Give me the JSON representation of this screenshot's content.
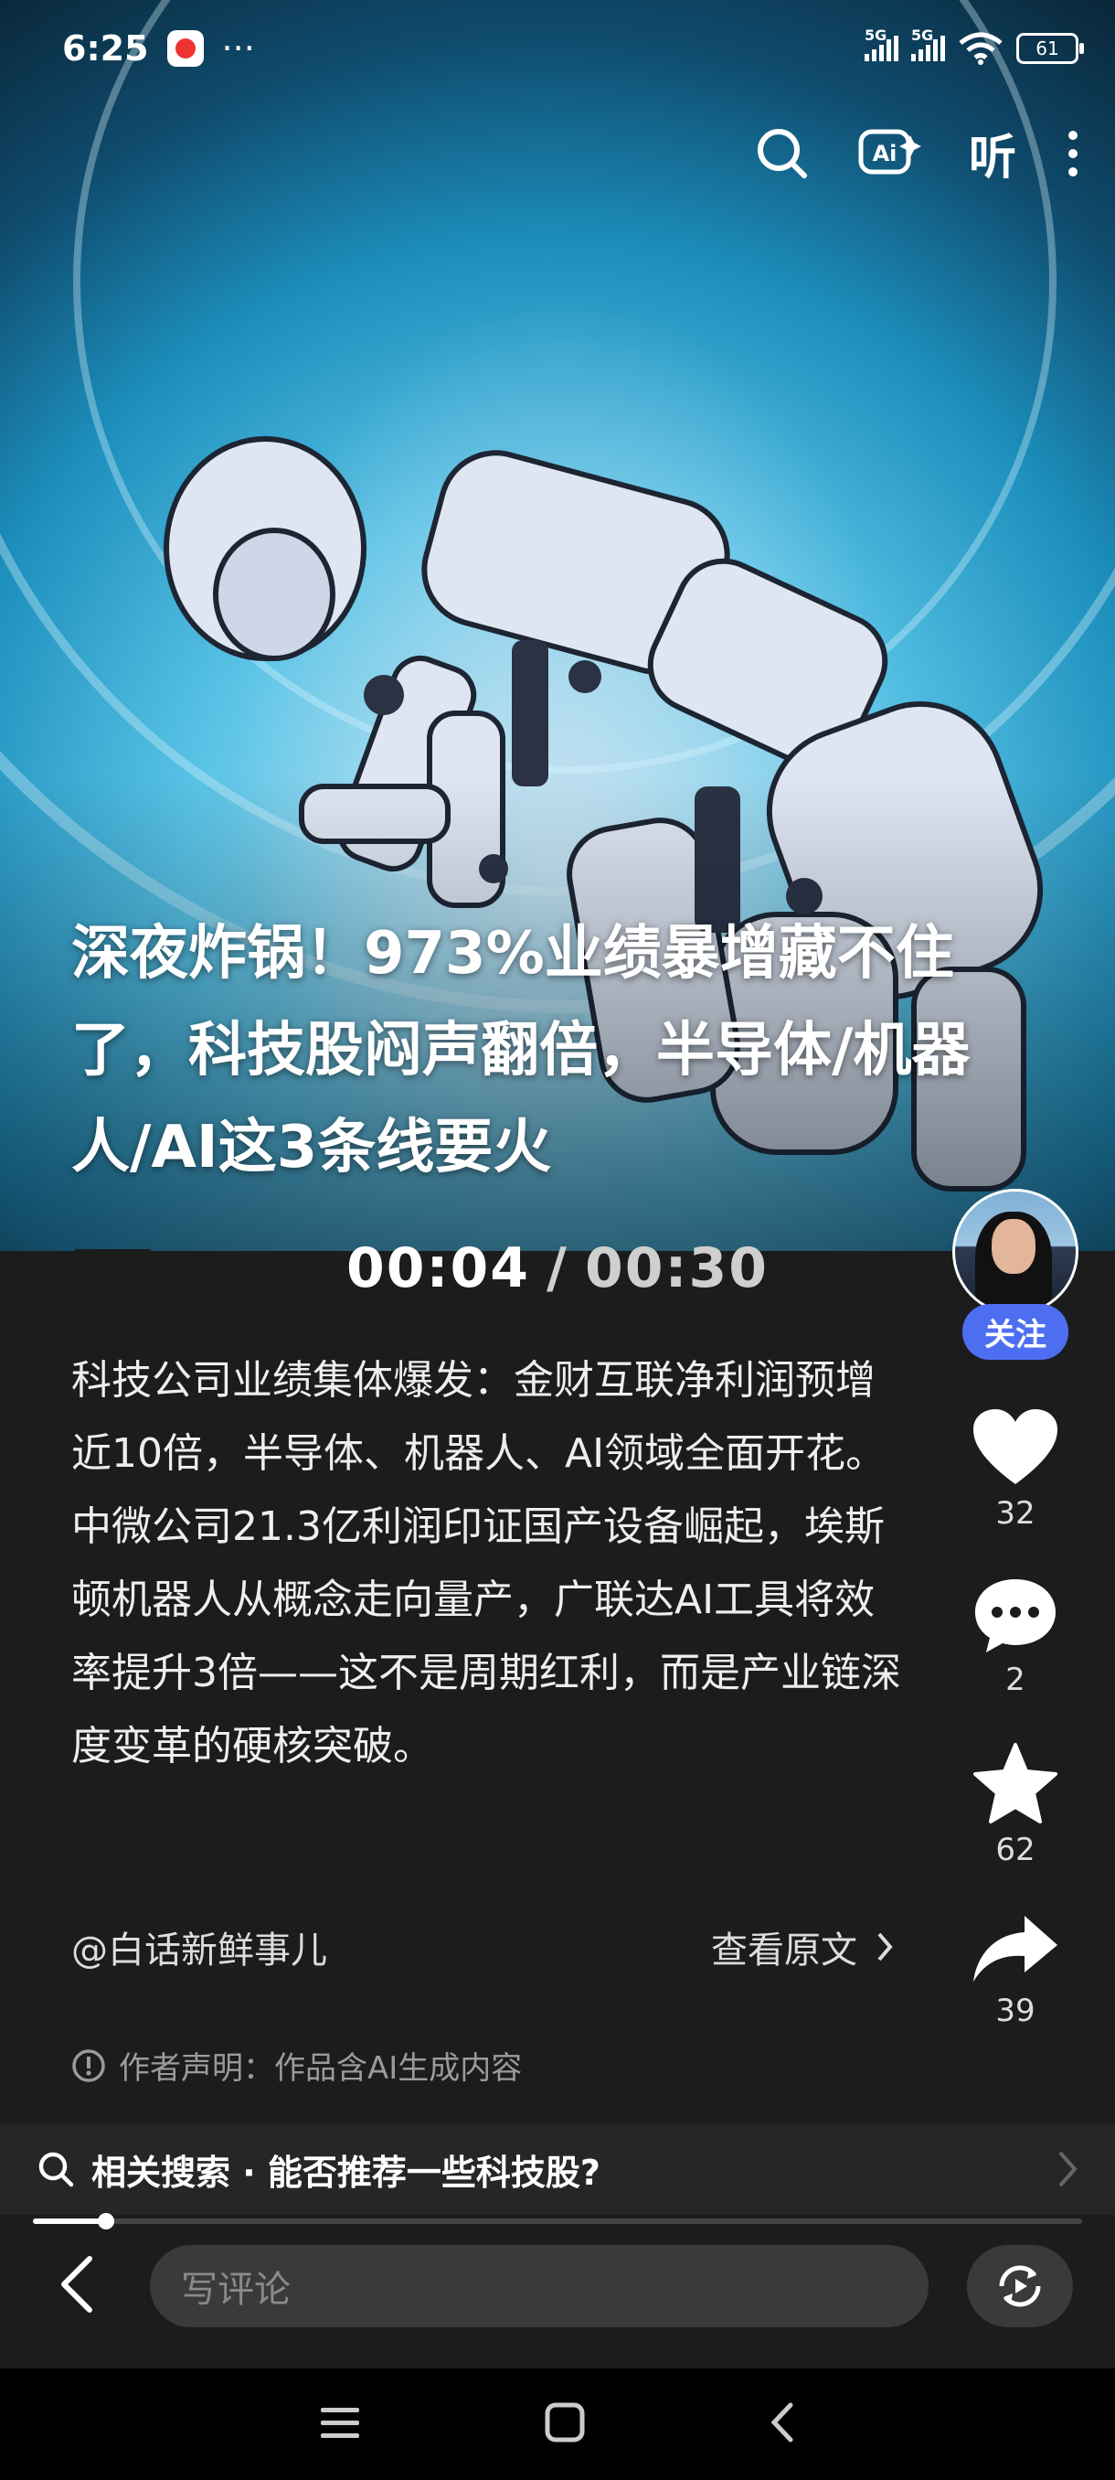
{
  "status_bar": {
    "time": "6:25",
    "more": "···",
    "network_1": "5G",
    "network_2": "5G",
    "battery": "61"
  },
  "toolbar": {
    "search_icon": "search-icon",
    "ai_label": "Ai",
    "listen_label": "听",
    "more_icon": "more-vertical-icon"
  },
  "hero": {
    "title": "深夜炸锅！973%业绩暴增藏不住了，科技股闷声翻倍，半导体/机器人/AI这3条线要火"
  },
  "player": {
    "current_time": "00:04",
    "separator": "/",
    "duration": "00:30",
    "progress": 0.07
  },
  "article": {
    "description": "科技公司业绩集体爆发：金财互联净利润预增近10倍，半导体、机器人、AI领域全面开花。中微公司21.3亿利润印证国产设备崛起，埃斯顿机器人从概念走向量产，广联达AI工具将效率提升3倍——这不是周期红利，而是产业链深度变革的硬核突破。",
    "author": "@白话新鲜事儿",
    "view_original": "查看原文",
    "declaration": "作者声明：作品含AI生成内容"
  },
  "side_actions": {
    "follow_label": "关注",
    "like_count": "32",
    "comment_count": "2",
    "favorite_count": "62",
    "share_count": "39"
  },
  "related_search": {
    "label": "相关搜索 · 能否推荐一些科技股?"
  },
  "comment_bar": {
    "placeholder": "写评论"
  },
  "colors": {
    "follow_button": "#4e6ef2",
    "background": "#1c1c1c"
  }
}
